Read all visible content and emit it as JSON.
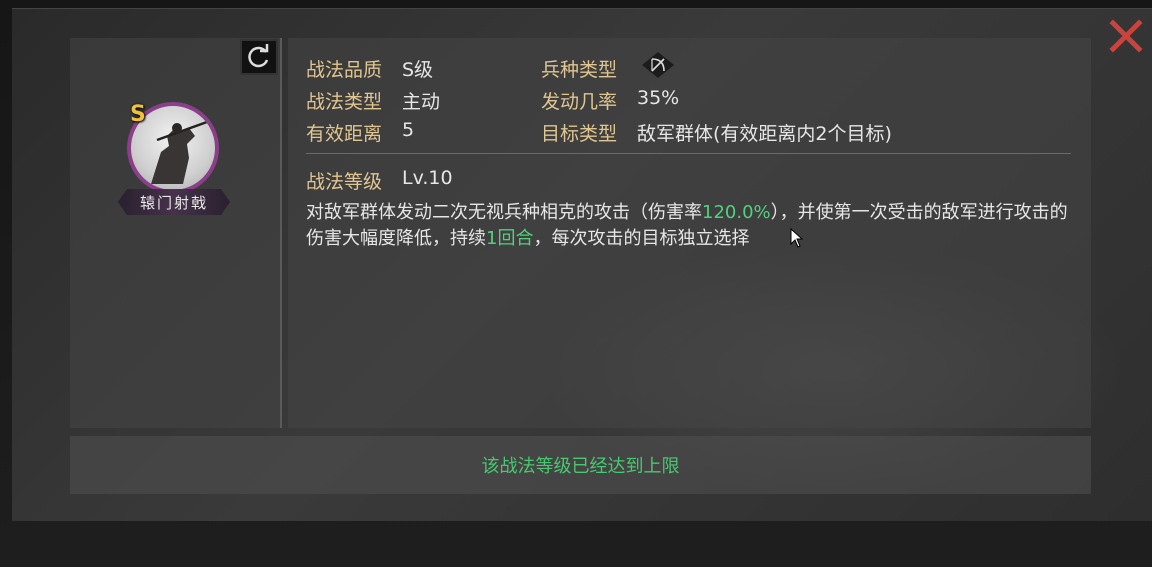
{
  "skill": {
    "name": "辕门射戟",
    "grade_badge": "S"
  },
  "attributes": {
    "quality_label": "战法品质",
    "quality_value": "S级",
    "troop_label": "兵种类型",
    "type_label": "战法类型",
    "type_value": "主动",
    "rate_label": "发动几率",
    "rate_value": "35%",
    "range_label": "有效距离",
    "range_value": "5",
    "target_label": "目标类型",
    "target_value": "敌军群体(有效距离内2个目标)",
    "level_label": "战法等级",
    "level_value": "Lv.10"
  },
  "description": {
    "part1": "对敌军群体发动二次无视兵种相克的攻击（伤害率",
    "damage_rate": "120.0%",
    "part2": "），并使第一次受击的敌军进行攻击的伤害大幅度降低，持续",
    "duration": "1回合",
    "part3": "，每次攻击的目标独立选择"
  },
  "footer": {
    "max_level_message": "该战法等级已经达到上限"
  },
  "icons": {
    "close": "close-icon",
    "refresh": "refresh-icon",
    "troop": "bow-troop-icon"
  },
  "colors": {
    "label": "#e0c690",
    "highlight": "#4fd27d",
    "close": "#c8443c",
    "avatar_ring": "#8b3e8a",
    "grade": "#f0c13a"
  }
}
